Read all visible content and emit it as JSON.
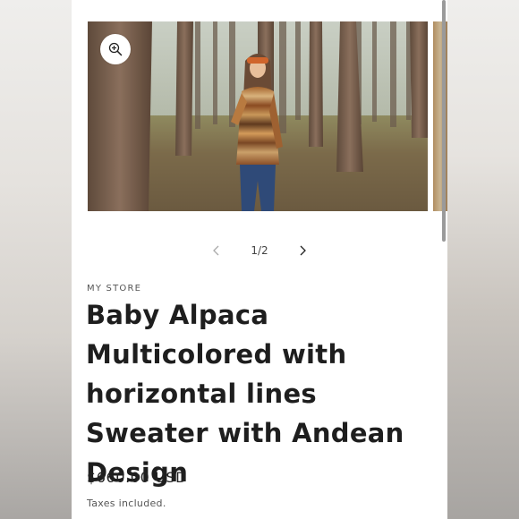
{
  "gallery": {
    "image_alt": "Woman wearing a striped alpaca sweater and orange headband in a eucalyptus forest",
    "zoom_icon": "zoom-in-icon",
    "current": 1,
    "total": 2,
    "counter_text": "1/2",
    "prev_icon": "chevron-left-icon",
    "next_icon": "chevron-right-icon"
  },
  "product": {
    "vendor": "MY STORE",
    "title": "Baby Alpaca Multicolored with horizontal lines Sweater with Andean Design",
    "price": "$660.00 USD",
    "tax_note": "Taxes included."
  },
  "colors": {
    "background": "#ffffff",
    "text": "#1e1e1e",
    "muted": "#555555"
  }
}
